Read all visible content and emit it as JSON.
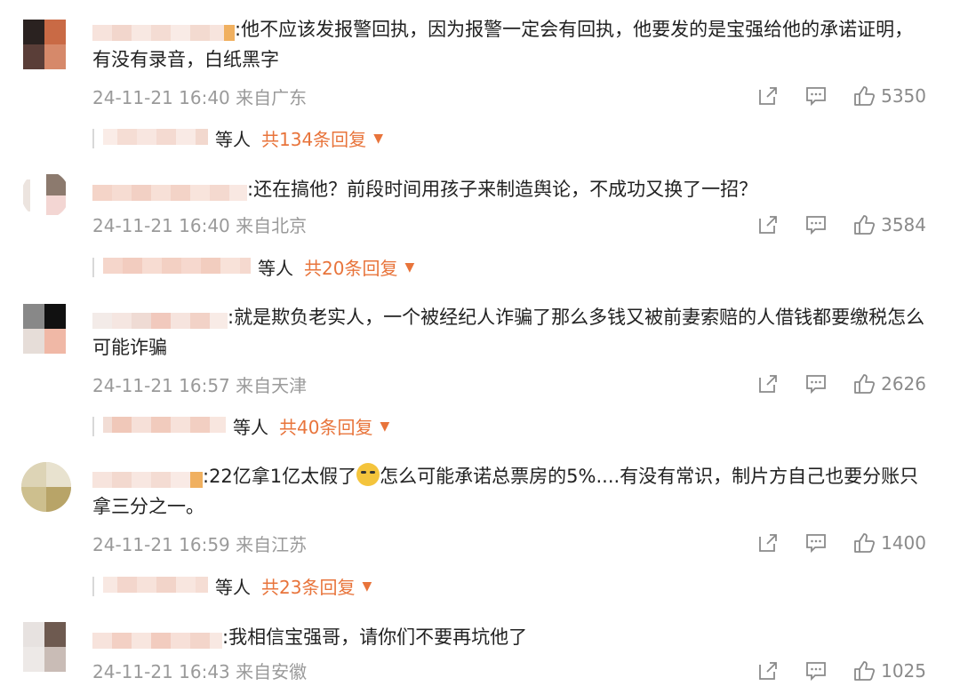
{
  "comments": [
    {
      "text": ":他不应该发报警回执，因为报警一定会有回执，他要发的是宝强给他的承诺证明，有没有录音，白纸黑字",
      "time": "24-11-21 16:40",
      "location": "来自广东",
      "likes": "5350",
      "reply_who": "等人",
      "reply_count": "共134条回复"
    },
    {
      "text": ":还在搞他？前段时间用孩子来制造舆论，不成功又换了一招？",
      "time": "24-11-21 16:40",
      "location": "来自北京",
      "likes": "3584",
      "reply_who": "等人",
      "reply_count": "共20条回复"
    },
    {
      "text": ":就是欺负老实人，一个被经纪人诈骗了那么多钱又被前妻索赔的人借钱都要缴税怎么可能诈骗",
      "time": "24-11-21 16:57",
      "location": "来自天津",
      "likes": "2626",
      "reply_who": "等人",
      "reply_count": "共40条回复"
    },
    {
      "text_a": ":22亿拿1亿太假了",
      "text_b": "怎么可能承诺总票房的5%....有没有常识，制片方自己也要分账只拿三分之一。",
      "time": "24-11-21 16:59",
      "location": "来自江苏",
      "likes": "1400",
      "reply_who": "等人",
      "reply_count": "共23条回复"
    },
    {
      "text": ":我相信宝强哥，请你们不要再坑他了",
      "time": "24-11-21 16:43",
      "location": "来自安徽",
      "likes": "1025"
    }
  ],
  "icons": {
    "share": "share-icon",
    "comment": "comment-icon",
    "like": "thumbs-up-icon",
    "expand": "caret-down-icon"
  },
  "colors": {
    "accent": "#e8743b",
    "meta": "#9a9a9a",
    "text": "#222222"
  }
}
